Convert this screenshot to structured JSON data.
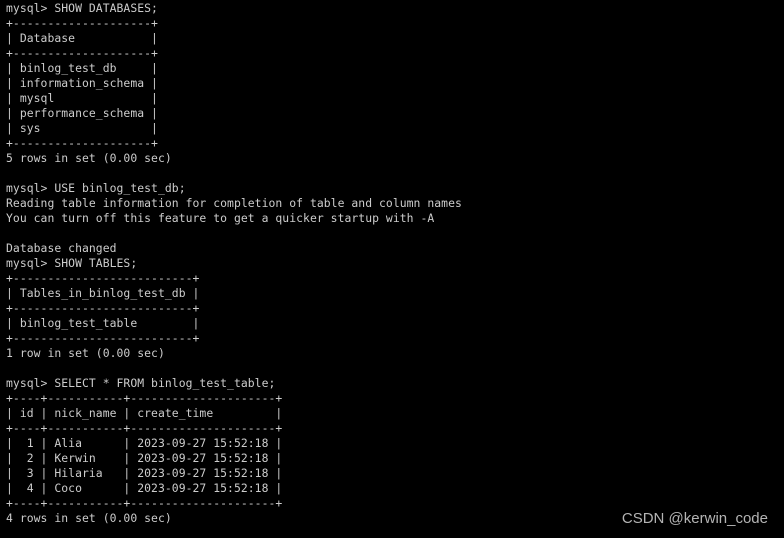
{
  "terminal": {
    "prompt": "mysql> ",
    "lines": [
      {
        "kind": "command",
        "text": "mysql> SHOW DATABASES;"
      },
      {
        "kind": "table-border",
        "text": "+--------------------+"
      },
      {
        "kind": "table-header",
        "text": "| Database           |"
      },
      {
        "kind": "table-border",
        "text": "+--------------------+"
      },
      {
        "kind": "table-row",
        "text": "| binlog_test_db     |"
      },
      {
        "kind": "table-row",
        "text": "| information_schema |"
      },
      {
        "kind": "table-row",
        "text": "| mysql              |"
      },
      {
        "kind": "table-row",
        "text": "| performance_schema |"
      },
      {
        "kind": "table-row",
        "text": "| sys                |"
      },
      {
        "kind": "table-border",
        "text": "+--------------------+"
      },
      {
        "kind": "status",
        "text": "5 rows in set (0.00 sec)"
      },
      {
        "kind": "blank",
        "text": ""
      },
      {
        "kind": "command",
        "text": "mysql> USE binlog_test_db;"
      },
      {
        "kind": "output",
        "text": "Reading table information for completion of table and column names"
      },
      {
        "kind": "output",
        "text": "You can turn off this feature to get a quicker startup with -A"
      },
      {
        "kind": "blank",
        "text": ""
      },
      {
        "kind": "output",
        "text": "Database changed"
      },
      {
        "kind": "command",
        "text": "mysql> SHOW TABLES;"
      },
      {
        "kind": "table-border",
        "text": "+--------------------------+"
      },
      {
        "kind": "table-header",
        "text": "| Tables_in_binlog_test_db |"
      },
      {
        "kind": "table-border",
        "text": "+--------------------------+"
      },
      {
        "kind": "table-row",
        "text": "| binlog_test_table        |"
      },
      {
        "kind": "table-border",
        "text": "+--------------------------+"
      },
      {
        "kind": "status",
        "text": "1 row in set (0.00 sec)"
      },
      {
        "kind": "blank",
        "text": ""
      },
      {
        "kind": "command",
        "text": "mysql> SELECT * FROM binlog_test_table;"
      },
      {
        "kind": "table-border",
        "text": "+----+-----------+---------------------+"
      },
      {
        "kind": "table-header",
        "text": "| id | nick_name | create_time         |"
      },
      {
        "kind": "table-border",
        "text": "+----+-----------+---------------------+"
      },
      {
        "kind": "table-row",
        "text": "|  1 | Alia      | 2023-09-27 15:52:18 |"
      },
      {
        "kind": "table-row",
        "text": "|  2 | Kerwin    | 2023-09-27 15:52:18 |"
      },
      {
        "kind": "table-row",
        "text": "|  3 | Hilaria   | 2023-09-27 15:52:18 |"
      },
      {
        "kind": "table-row",
        "text": "|  4 | Coco      | 2023-09-27 15:52:18 |"
      },
      {
        "kind": "table-border",
        "text": "+----+-----------+---------------------+"
      },
      {
        "kind": "status",
        "text": "4 rows in set (0.00 sec)"
      }
    ]
  },
  "queries": [
    {
      "command": "SHOW DATABASES;",
      "columns": [
        "Database"
      ],
      "rows": [
        [
          "binlog_test_db"
        ],
        [
          "information_schema"
        ],
        [
          "mysql"
        ],
        [
          "performance_schema"
        ],
        [
          "sys"
        ]
      ],
      "status": "5 rows in set (0.00 sec)"
    },
    {
      "command": "USE binlog_test_db;",
      "messages": [
        "Reading table information for completion of table and column names",
        "You can turn off this feature to get a quicker startup with -A",
        "",
        "Database changed"
      ]
    },
    {
      "command": "SHOW TABLES;",
      "columns": [
        "Tables_in_binlog_test_db"
      ],
      "rows": [
        [
          "binlog_test_table"
        ]
      ],
      "status": "1 row in set (0.00 sec)"
    },
    {
      "command": "SELECT * FROM binlog_test_table;",
      "columns": [
        "id",
        "nick_name",
        "create_time"
      ],
      "rows": [
        [
          "1",
          "Alia",
          "2023-09-27 15:52:18"
        ],
        [
          "2",
          "Kerwin",
          "2023-09-27 15:52:18"
        ],
        [
          "3",
          "Hilaria",
          "2023-09-27 15:52:18"
        ],
        [
          "4",
          "Coco",
          "2023-09-27 15:52:18"
        ]
      ],
      "status": "4 rows in set (0.00 sec)"
    }
  ],
  "watermark": "CSDN @kerwin_code",
  "colors": {
    "background": "#000000",
    "text": "#cccccc",
    "watermark": "#b4b4b4"
  }
}
